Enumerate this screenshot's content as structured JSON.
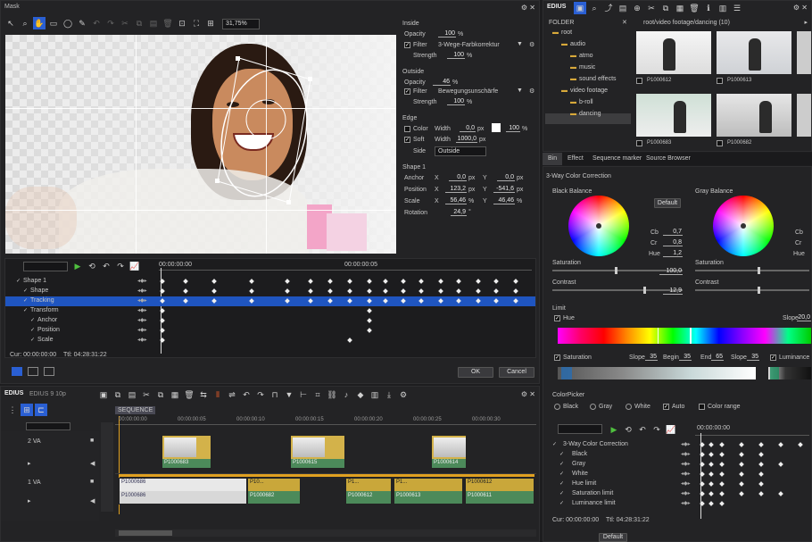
{
  "mask": {
    "title": "Mask",
    "zoom": "31,75%",
    "inside": {
      "heading": "Inside",
      "opacity_label": "Opacity",
      "opacity": "100",
      "filter_label": "Filter",
      "filter": "3-Wege-Farbkorrektur",
      "strength_label": "Strength",
      "strength": "100",
      "unit": "%"
    },
    "outside": {
      "heading": "Outside",
      "opacity_label": "Opacity",
      "opacity": "46",
      "filter_label": "Filter",
      "filter": "Bewegungsunschärfe",
      "strength_label": "Strength",
      "strength": "100",
      "unit": "%"
    },
    "edge": {
      "heading": "Edge",
      "color_label": "Color",
      "width_label": "Width",
      "color_width": "0,0",
      "px": "px",
      "color_pct": "100",
      "soft_label": "Soft",
      "soft_width": "1000,0",
      "side_label": "Side",
      "side": "Outside"
    },
    "shape": {
      "heading": "Shape 1",
      "anchor_label": "Anchor",
      "position_label": "Position",
      "scale_label": "Scale",
      "rotation_label": "Rotation",
      "anchor_x": "0,0",
      "anchor_y": "0,0",
      "position_x": "123,2",
      "position_y": "-541,6",
      "scale_x": "56,46",
      "scale_y": "46,46",
      "rotation": "24,9",
      "x": "X",
      "y": "Y",
      "px": "px",
      "pct": "%"
    },
    "timecode_start": "00:00:00:00",
    "timecode_mid": "00:00:00:05",
    "tracks": [
      "Shape 1",
      "Shape",
      "Tracking",
      "Transform",
      "Anchor",
      "Position",
      "Scale"
    ],
    "cur": "Cur: 00:00:00:00",
    "ttl": "Ttl: 04:28:31:22",
    "ok": "OK",
    "cancel": "Cancel"
  },
  "bin": {
    "app": "EDIUS",
    "folder_label": "FOLDER",
    "path": "root/video footage/dancing (10)",
    "tree": [
      "root",
      "audio",
      "atmo",
      "music",
      "sound effects",
      "video footage",
      "b-roll",
      "dancing"
    ],
    "clips": [
      "P1000612",
      "P1000613",
      "P1000683",
      "P1000682"
    ]
  },
  "tabs": [
    "Bin",
    "Effect",
    "Sequence marker",
    "Source Browser"
  ],
  "color": {
    "title": "3-Way Color Correction",
    "black_balance": "Black Balance",
    "gray_balance": "Gray Balance",
    "default": "Default",
    "cb_label": "Cb",
    "cr_label": "Cr",
    "hue_label": "Hue",
    "cb": "0,7",
    "cr": "0,8",
    "hue": "1,2",
    "saturation_label": "Saturation",
    "saturation": "100,0",
    "contrast_label": "Contrast",
    "contrast": "12,9",
    "limit": "Limit",
    "hue_chk": "Hue",
    "slope_label": "Slope",
    "slope": "20,0",
    "sat_chk": "Saturation",
    "begin_label": "Begin",
    "end_label": "End",
    "lum_chk": "Luminance",
    "slope2": "35",
    "begin": "35",
    "end": "65",
    "slope3": "35",
    "colorpicker": "ColorPicker",
    "black": "Black",
    "gray": "Gray",
    "white": "White",
    "auto": "Auto",
    "color_range": "Color range",
    "timecode": "00:00:00:00",
    "fx_tracks": [
      "3-Way Color Correction",
      "Black",
      "Gray",
      "White",
      "Hue limit",
      "Saturation limit",
      "Luminance limit"
    ],
    "cur": "Cur: 00:00:00:00",
    "ttl": "Ttl: 04:28:31:22",
    "default_btn": "Default"
  },
  "timeline": {
    "app": "EDIUS",
    "version": "EDIUS 9 10p",
    "sequence": "SEQUENCE",
    "times": [
      "00:00:00:00",
      "00:00:00:05",
      "00:00:00:10",
      "00:00:00:15",
      "00:00:00:20",
      "00:00:00:25",
      "00:00:00:30"
    ],
    "track_va2": "2 VA",
    "track_va1": "1 VA",
    "va2_clips": [
      "P1000683",
      "P1000615",
      "P1000614"
    ],
    "va1_clips": [
      "P1000686",
      "P1000682",
      "P1000612",
      "P1000613",
      "P1000611"
    ],
    "va1_top": [
      "P1000686",
      "P10...",
      "P1...",
      "P1...",
      "P1000612"
    ]
  }
}
